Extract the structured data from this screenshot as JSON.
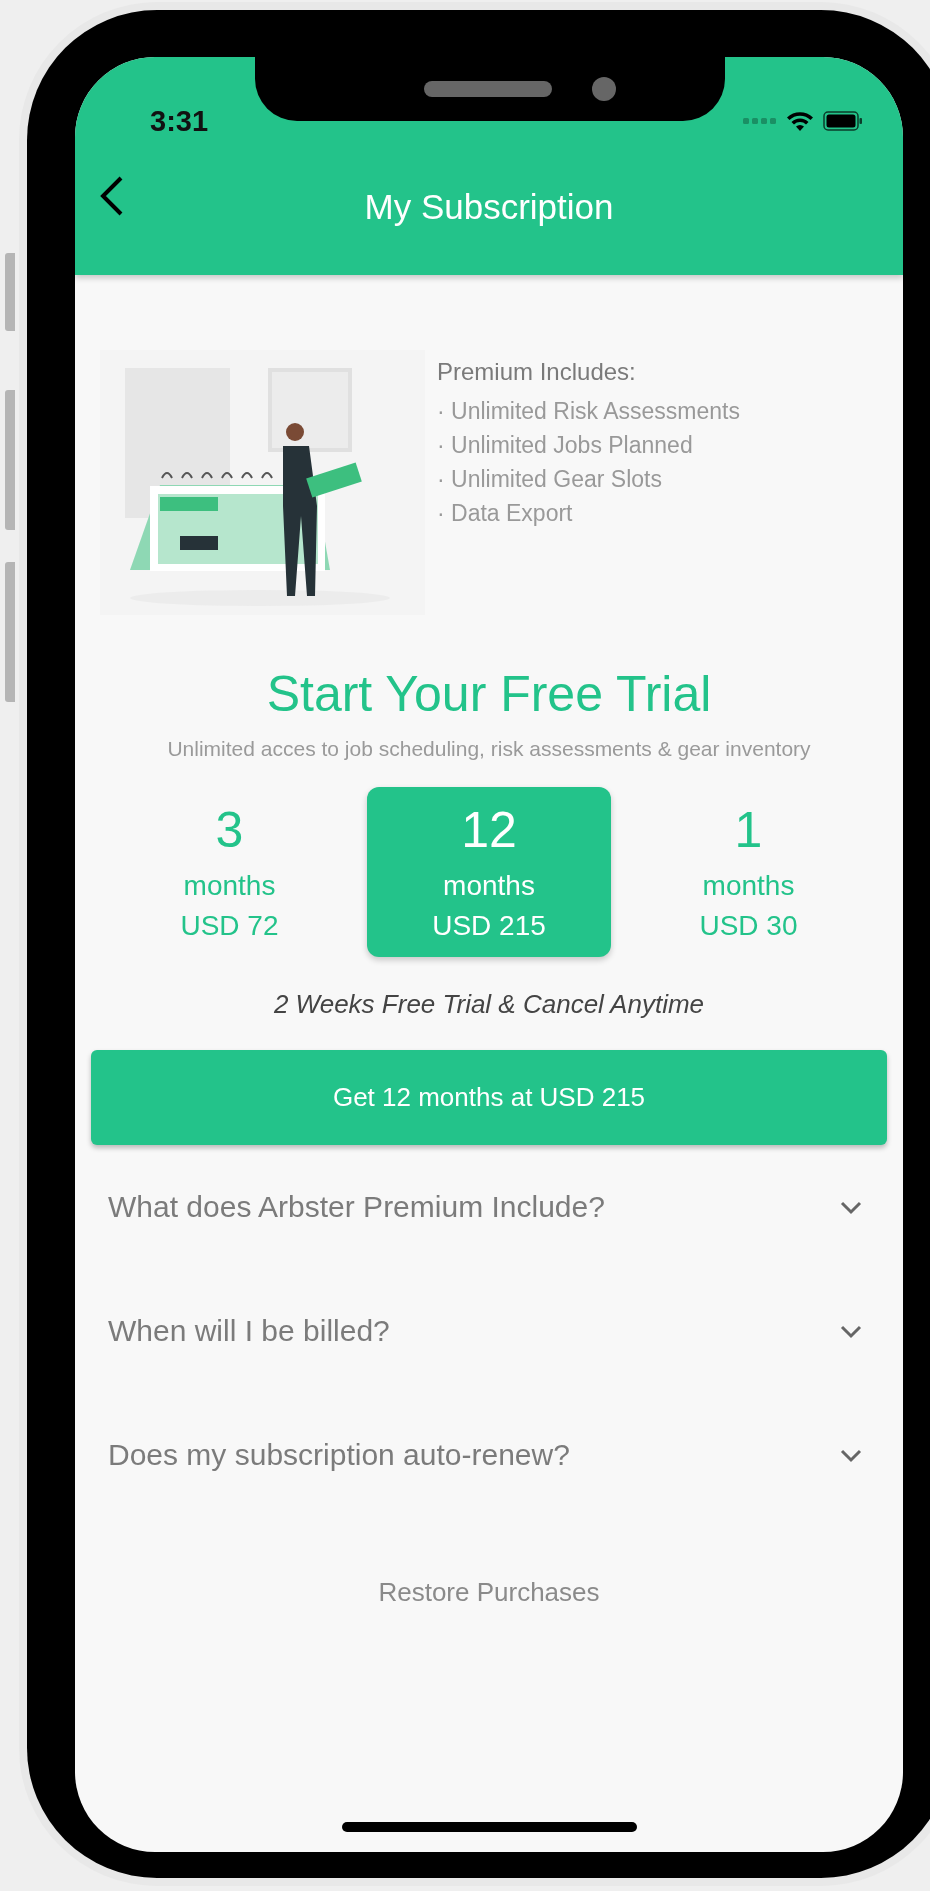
{
  "status_bar": {
    "time": "3:31"
  },
  "header": {
    "title": "My Subscription"
  },
  "premium": {
    "heading": "Premium Includes:",
    "items": [
      "· Unlimited Risk Assessments",
      "· Unlimited Jobs Planned",
      "· Unlimited Gear Slots",
      "· Data Export"
    ]
  },
  "headline": "Start Your Free Trial",
  "subtitle": "Unlimited acces to job scheduling, risk assessments & gear inventory",
  "plans": [
    {
      "count": "3",
      "unit": "months",
      "price": "USD 72",
      "selected": false
    },
    {
      "count": "12",
      "unit": "months",
      "price": "USD 215",
      "selected": true
    },
    {
      "count": "1",
      "unit": "months",
      "price": "USD 30",
      "selected": false
    }
  ],
  "trial_note": "2 Weeks Free Trial & Cancel Anytime",
  "cta_button": "Get 12 months at USD 215",
  "faqs": [
    {
      "question": "What does Arbster Premium Include?",
      "expanded": false
    },
    {
      "question": "When will I be billed?",
      "expanded": false
    },
    {
      "question": "Does my subscription auto-renew?",
      "expanded": false
    }
  ],
  "restore_link": "Restore Purchases"
}
